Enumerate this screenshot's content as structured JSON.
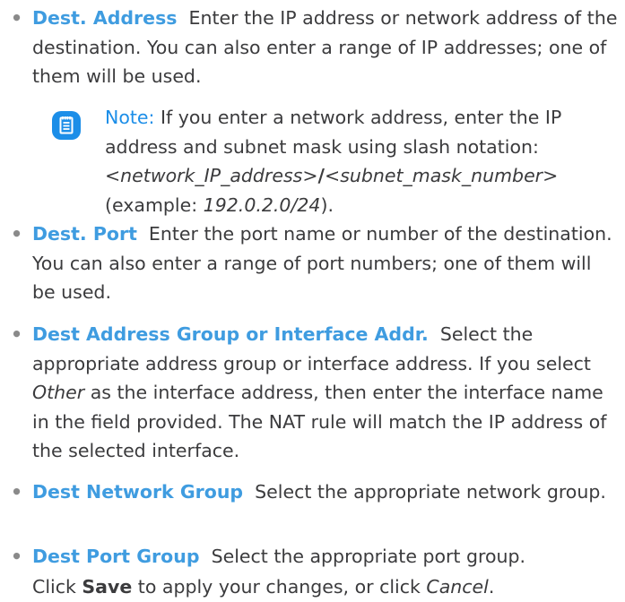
{
  "items": [
    {
      "term": "Dest. Address",
      "text": "Enter the IP address or network address of the destination. You can also enter a range of IP addresses; one of them will be used."
    },
    {
      "term": "Dest. Port",
      "text": "Enter the port name or number of the destination. You can also enter a range of port numbers; one of them will be used."
    },
    {
      "term": "Dest Address Group or Interface Addr.",
      "text_before": "Select the appropriate address group or interface address. If you select",
      "text_italic": "Other",
      "text_after": "as the interface address, then enter the interface name in the field provided. The NAT rule will match the IP address of the selected interface."
    },
    {
      "term": "Dest Network Group",
      "text": "Select the appropriate network group."
    },
    {
      "term": "Dest Port Group",
      "text": "Select the appropriate port group."
    }
  ],
  "bullet_char": "•",
  "note": {
    "icon": "note-icon",
    "label": "Note:",
    "text": "If you enter a network address, enter the IP address and subnet mask using slash notation:",
    "syntax_1": "<network_IP_address>",
    "syntax_sep": "/",
    "syntax_2": "<subnet_mask_number>",
    "example_open": "(example: ",
    "example_value": "192.0.2.0/24",
    "example_close": ")."
  },
  "footer": {
    "text_1": "Click",
    "save": "Save",
    "text_2": "to apply your changes, or click",
    "cancel": "Cancel",
    "text_3": "."
  },
  "colors": {
    "term": "#3f9ce0",
    "note_accent": "#1c8ee8",
    "body_text": "#3b3b3d"
  }
}
